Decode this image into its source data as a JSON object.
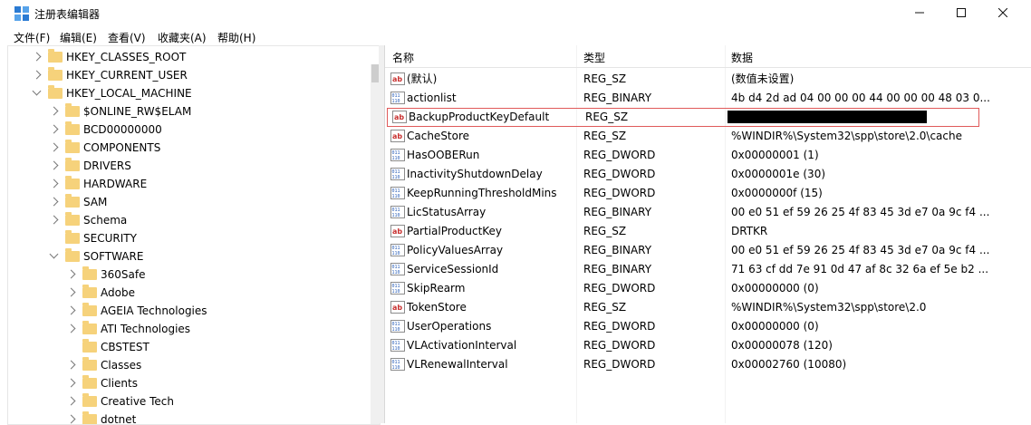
{
  "window": {
    "title": "注册表编辑器"
  },
  "menu": [
    "文件(F)",
    "编辑(E)",
    "查看(V)",
    "收藏夹(A)",
    "帮助(H)"
  ],
  "tree": [
    {
      "label": "HKEY_CLASSES_ROOT",
      "level": 0,
      "state": "collapsed"
    },
    {
      "label": "HKEY_CURRENT_USER",
      "level": 0,
      "state": "collapsed"
    },
    {
      "label": "HKEY_LOCAL_MACHINE",
      "level": 0,
      "state": "expanded"
    },
    {
      "label": "$ONLINE_RW$ELAM",
      "level": 1,
      "state": "collapsed"
    },
    {
      "label": "BCD00000000",
      "level": 1,
      "state": "collapsed"
    },
    {
      "label": "COMPONENTS",
      "level": 1,
      "state": "collapsed"
    },
    {
      "label": "DRIVERS",
      "level": 1,
      "state": "collapsed"
    },
    {
      "label": "HARDWARE",
      "level": 1,
      "state": "collapsed"
    },
    {
      "label": "SAM",
      "level": 1,
      "state": "collapsed"
    },
    {
      "label": "Schema",
      "level": 1,
      "state": "collapsed"
    },
    {
      "label": "SECURITY",
      "level": 1,
      "state": "none"
    },
    {
      "label": "SOFTWARE",
      "level": 1,
      "state": "expanded"
    },
    {
      "label": "360Safe",
      "level": 2,
      "state": "collapsed"
    },
    {
      "label": "Adobe",
      "level": 2,
      "state": "collapsed"
    },
    {
      "label": "AGEIA Technologies",
      "level": 2,
      "state": "collapsed"
    },
    {
      "label": "ATI Technologies",
      "level": 2,
      "state": "collapsed"
    },
    {
      "label": "CBSTEST",
      "level": 2,
      "state": "none"
    },
    {
      "label": "Classes",
      "level": 2,
      "state": "collapsed"
    },
    {
      "label": "Clients",
      "level": 2,
      "state": "collapsed"
    },
    {
      "label": "Creative Tech",
      "level": 2,
      "state": "collapsed"
    },
    {
      "label": "dotnet",
      "level": 2,
      "state": "collapsed"
    }
  ],
  "columns": {
    "name": "名称",
    "type": "类型",
    "data": "数据"
  },
  "values": [
    {
      "name": "(默认)",
      "type": "REG_SZ",
      "data": "(数值未设置)",
      "icon": "string"
    },
    {
      "name": "actionlist",
      "type": "REG_BINARY",
      "data": "4b d4 2d ad 04 00 00 00 44 00 00 00 48 03 0...",
      "icon": "binary"
    },
    {
      "name": "BackupProductKeyDefault",
      "type": "REG_SZ",
      "data": "",
      "icon": "string",
      "selected": true,
      "redacted": true
    },
    {
      "name": "CacheStore",
      "type": "REG_SZ",
      "data": "%WINDIR%\\System32\\spp\\store\\2.0\\cache",
      "icon": "string"
    },
    {
      "name": "HasOOBERun",
      "type": "REG_DWORD",
      "data": "0x00000001 (1)",
      "icon": "binary"
    },
    {
      "name": "InactivityShutdownDelay",
      "type": "REG_DWORD",
      "data": "0x0000001e (30)",
      "icon": "binary"
    },
    {
      "name": "KeepRunningThresholdMins",
      "type": "REG_DWORD",
      "data": "0x0000000f (15)",
      "icon": "binary"
    },
    {
      "name": "LicStatusArray",
      "type": "REG_BINARY",
      "data": "00 e0 51 ef 59 26 25 4f 83 45 3d e7 0a 9c f4 ...",
      "icon": "binary"
    },
    {
      "name": "PartialProductKey",
      "type": "REG_SZ",
      "data": "DRTKR",
      "icon": "string"
    },
    {
      "name": "PolicyValuesArray",
      "type": "REG_BINARY",
      "data": "00 e0 51 ef 59 26 25 4f 83 45 3d e7 0a 9c f4 ...",
      "icon": "binary"
    },
    {
      "name": "ServiceSessionId",
      "type": "REG_BINARY",
      "data": "71 63 cf dd 7e 91 0d 47 af 8c 32 6a ef 5e b2 ...",
      "icon": "binary"
    },
    {
      "name": "SkipRearm",
      "type": "REG_DWORD",
      "data": "0x00000000 (0)",
      "icon": "binary"
    },
    {
      "name": "TokenStore",
      "type": "REG_SZ",
      "data": "%WINDIR%\\System32\\spp\\store\\2.0",
      "icon": "string"
    },
    {
      "name": "UserOperations",
      "type": "REG_DWORD",
      "data": "0x00000000 (0)",
      "icon": "binary"
    },
    {
      "name": "VLActivationInterval",
      "type": "REG_DWORD",
      "data": "0x00000078 (120)",
      "icon": "binary"
    },
    {
      "name": "VLRenewalInterval",
      "type": "REG_DWORD",
      "data": "0x00002760 (10080)",
      "icon": "binary"
    }
  ]
}
